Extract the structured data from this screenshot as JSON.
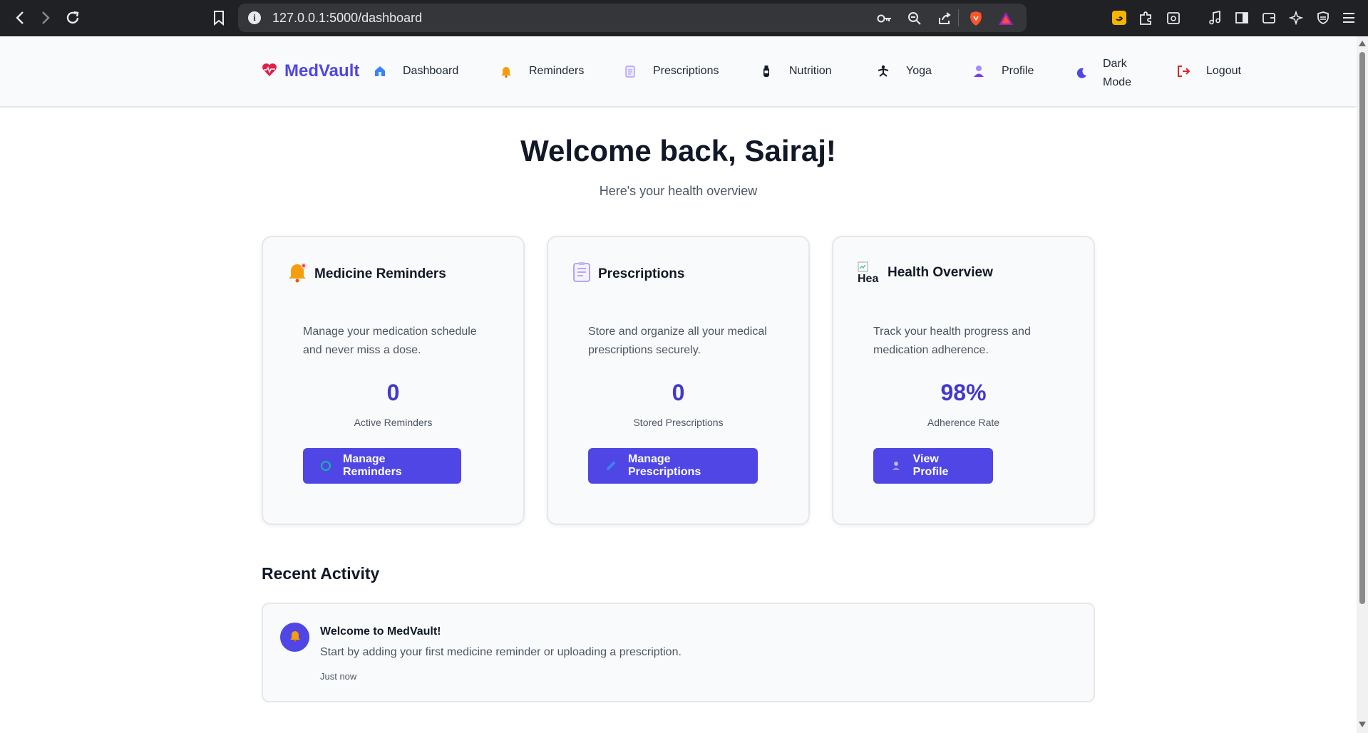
{
  "browser": {
    "url": "127.0.0.1:5000/dashboard"
  },
  "nav": {
    "brand": "MedVault",
    "items": [
      {
        "label": "Dashboard",
        "icon": "home-icon"
      },
      {
        "label": "Reminders",
        "icon": "bell-icon"
      },
      {
        "label": "Prescriptions",
        "icon": "clipboard-icon"
      },
      {
        "label": "Nutrition",
        "icon": "bottle-icon"
      },
      {
        "label": "Yoga",
        "icon": "yoga-icon"
      },
      {
        "label": "Profile",
        "icon": "user-icon"
      },
      {
        "label": "Dark\nMode",
        "icon": "moon-icon"
      },
      {
        "label": "Logout",
        "icon": "logout-icon"
      }
    ]
  },
  "welcome": {
    "title": "Welcome back, Sairaj!",
    "subtitle": "Here's your health overview"
  },
  "cards": [
    {
      "title": "Medicine Reminders",
      "icon": "bell-icon",
      "description": "Manage your medication schedule and never miss a dose.",
      "stat": "0",
      "stat_label": "Active Reminders",
      "button": "Manage Reminders"
    },
    {
      "title": "Prescriptions",
      "icon": "clipboard-icon",
      "description": "Store and organize all your medical prescriptions securely.",
      "stat": "0",
      "stat_label": "Stored Prescriptions",
      "button": "Manage Prescriptions"
    },
    {
      "title": "Health Overview",
      "icon": "broken-image-icon",
      "icon_alt": "Hea",
      "description": "Track your health progress and medication adherence.",
      "stat": "98%",
      "stat_label": "Adherence Rate",
      "button": "View Profile"
    }
  ],
  "recent": {
    "title": "Recent Activity",
    "items": [
      {
        "title": "Welcome to MedVault!",
        "text": "Start by adding your first medicine reminder or uploading a prescription.",
        "time": "Just now"
      }
    ]
  },
  "colors": {
    "accent": "#4f46e5",
    "stat": "#4338ca",
    "brand_heart": "#e11d48",
    "bell": "#f59e0b"
  }
}
